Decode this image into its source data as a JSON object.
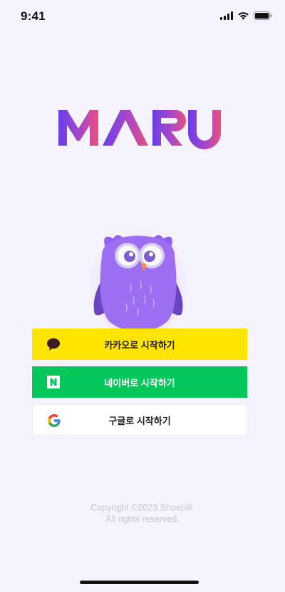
{
  "status_bar": {
    "time": "9:41",
    "icons": [
      "cellular-signal-icon",
      "wifi-icon",
      "battery-icon"
    ]
  },
  "brand": {
    "logo_text": "MARU",
    "gradient": [
      "#6a3de8",
      "#e8507c"
    ]
  },
  "mascot": {
    "name": "owl-mascot",
    "color": "#9a6df0"
  },
  "login": {
    "kakao_label": "카카오로 시작하기",
    "naver_label": "네이버로 시작하기",
    "google_label": "구글로 시작하기",
    "kakao_color": "#fee500",
    "naver_color": "#03c75a",
    "google_color": "#ffffff"
  },
  "footer": {
    "copyright_line1": "Copyright ©2023 Shoebill.",
    "copyright_line2": "All rights reserved."
  }
}
